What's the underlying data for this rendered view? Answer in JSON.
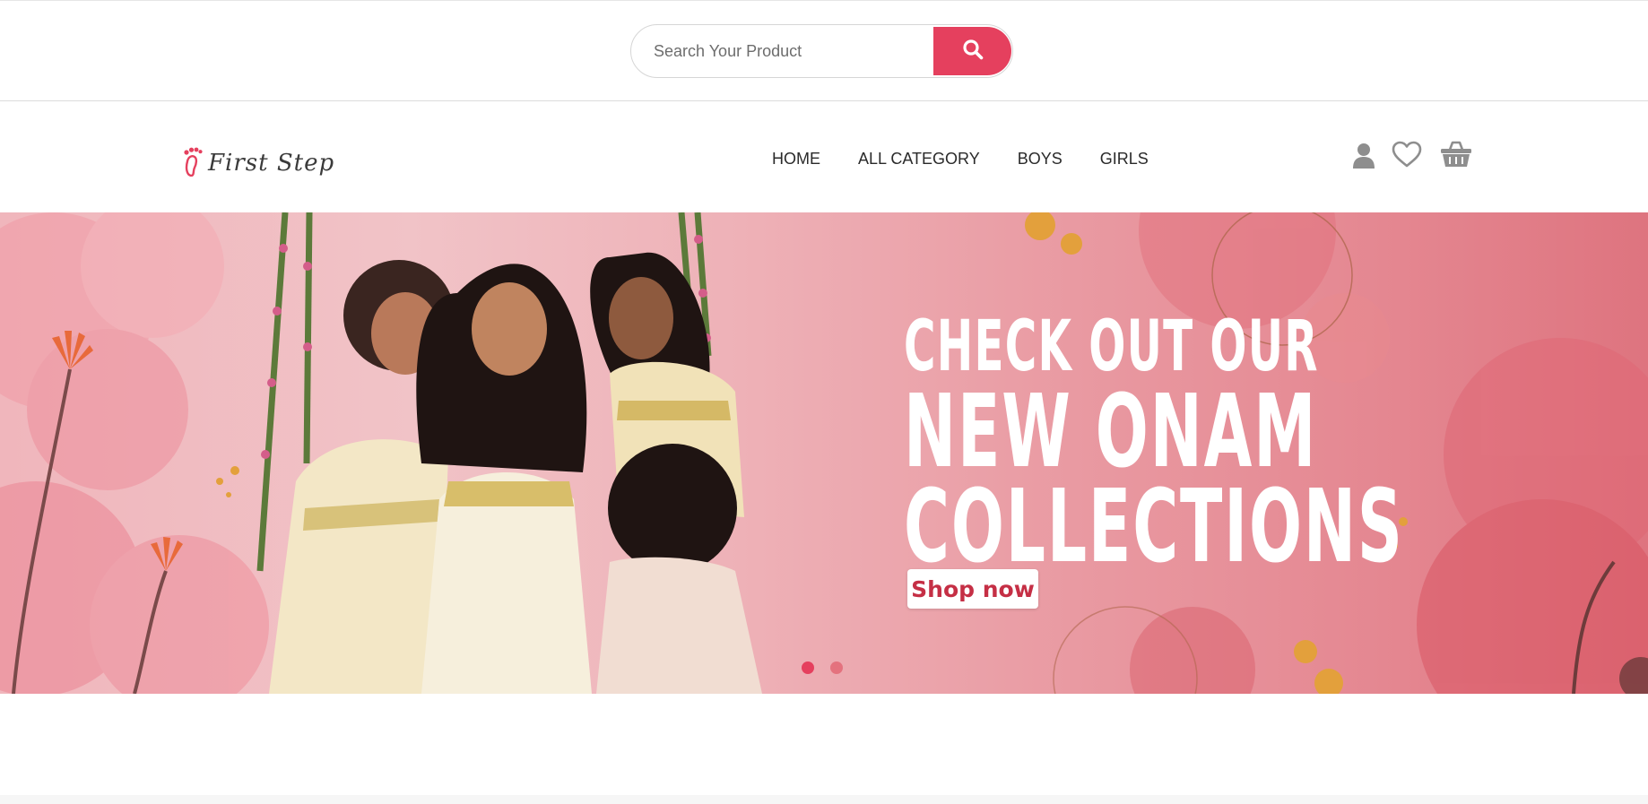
{
  "search": {
    "placeholder": "Search Your Product",
    "value": ""
  },
  "brand": {
    "name": "First Step",
    "accent_color": "#e5405e"
  },
  "nav": {
    "items": [
      "HOME",
      "ALL CATEGORY",
      "BOYS",
      "GIRLS"
    ]
  },
  "header_icons": [
    "user-icon",
    "heart-icon",
    "basket-icon"
  ],
  "banner": {
    "headline_line1": "CHECK OUT OUR",
    "headline_line2": "NEW ONAM",
    "headline_line3": "COLLECTIONS",
    "cta_label": "Shop now",
    "slide_count": 2,
    "active_slide": 1
  }
}
